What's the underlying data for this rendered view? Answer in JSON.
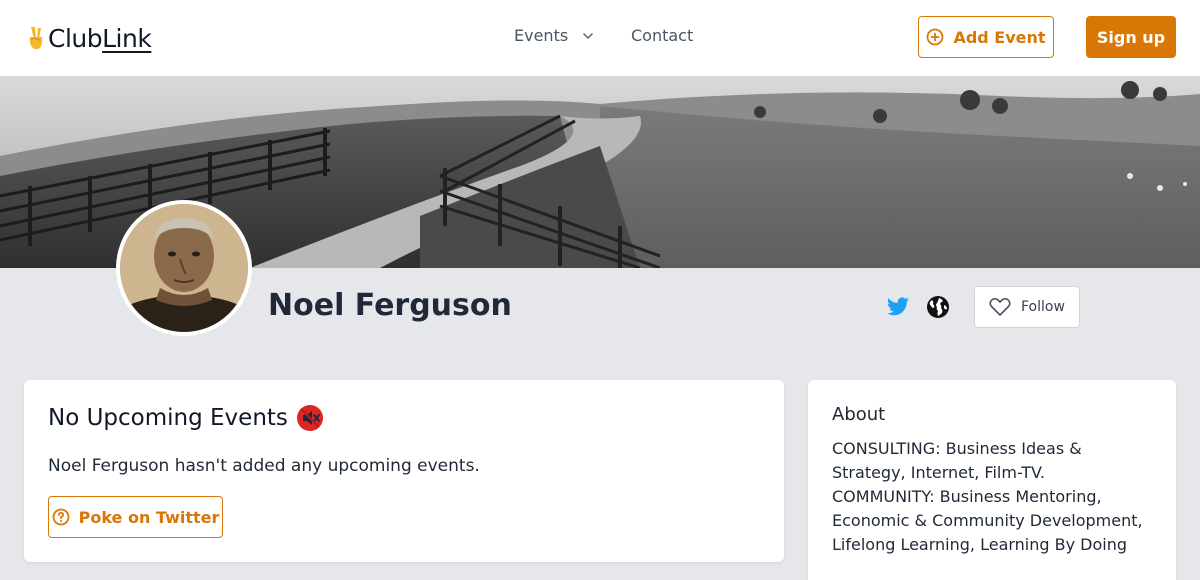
{
  "header": {
    "logo_text_plain": "Club",
    "logo_text_link": "Link",
    "logo_icon": "victory-hand-icon",
    "nav": {
      "events_label": "Events",
      "contact_label": "Contact"
    },
    "add_event_label": "Add Event",
    "sign_up_label": "Sign up"
  },
  "profile": {
    "name": "Noel Ferguson",
    "follow_label": "Follow",
    "social_icons": [
      "twitter-icon",
      "globe-icon"
    ]
  },
  "events_card": {
    "heading": "No Upcoming Events",
    "heading_icon": "muted-speaker-icon",
    "message": "Noel Ferguson hasn't added any upcoming events.",
    "poke_label": "Poke on Twitter"
  },
  "about_card": {
    "heading": "About",
    "text": "CONSULTING: Business Ideas & Strategy, Internet, Film-TV. COMMUNITY: Business Mentoring, Economic & Community Development, Lifelong Learning, Learning By Doing"
  },
  "colors": {
    "accent": "#d97706",
    "background": "#e5e7eb",
    "twitter": "#1da1f2",
    "text": "#1f2937"
  }
}
